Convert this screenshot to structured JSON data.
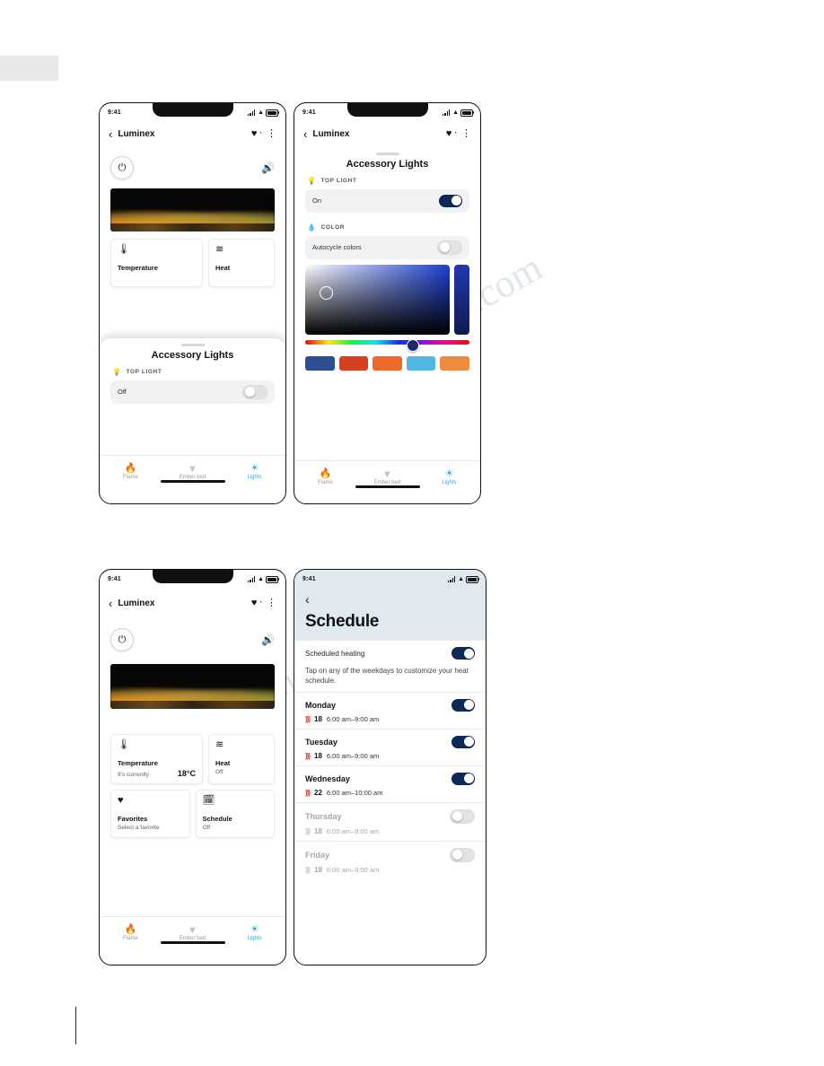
{
  "watermark": {
    "line1": "ve.com",
    "line2": "manualshive."
  },
  "screens": [
    {
      "id": "screen-1",
      "status": {
        "time": "9:41",
        "icons": [
          "signal-icon",
          "wifi-icon",
          "battery-icon"
        ]
      },
      "nav": {
        "back": "‹",
        "title": "Luminex",
        "favorite_icon": "heart-icon",
        "menu_icon": "overflow-menu-icon"
      },
      "controls": {
        "power_icon": "power-icon",
        "speaker_icon": "speaker-icon"
      },
      "tiles": [
        {
          "icon": "thermometer-icon",
          "title": "Temperature",
          "sub": "",
          "value": ""
        },
        {
          "icon": "heat-waves-icon",
          "title": "Heat",
          "sub": "",
          "value": ""
        }
      ],
      "sheet": {
        "title": "Accessory Lights",
        "section_label": "TOP LIGHT",
        "section_icon": "bulb-icon",
        "row_label": "Off",
        "toggle_state": "off"
      },
      "tabs": [
        {
          "icon": "flame-icon",
          "label": "Flame",
          "active": false
        },
        {
          "icon": "ember-bed-icon",
          "label": "Ember bed",
          "active": false
        },
        {
          "icon": "lights-icon",
          "label": "Lights",
          "active": true
        }
      ]
    },
    {
      "id": "screen-2",
      "status": {
        "time": "9:41"
      },
      "nav": {
        "back": "‹",
        "title": "Luminex",
        "favorite_icon": "heart-icon",
        "menu_icon": "overflow-menu-icon"
      },
      "sheet": {
        "title": "Accessory Lights",
        "section_label": "TOP LIGHT",
        "section_icon": "bulb-icon",
        "row_label": "On",
        "toggle_state": "on",
        "color_section_label": "COLOR",
        "color_section_icon": "droplet-icon",
        "autocycle_label": "Autocycle colors",
        "autocycle_state": "off"
      },
      "swatches": [
        "#2d4f91",
        "#d6401f",
        "#ee6a2b",
        "#52b7e2",
        "#ef8a3c"
      ],
      "tabs": [
        {
          "icon": "flame-icon",
          "label": "Flame",
          "active": false
        },
        {
          "icon": "ember-bed-icon",
          "label": "Ember bed",
          "active": false
        },
        {
          "icon": "lights-icon",
          "label": "Lights",
          "active": true
        }
      ]
    },
    {
      "id": "screen-3",
      "status": {
        "time": "9:41"
      },
      "nav": {
        "back": "‹",
        "title": "Luminex",
        "favorite_icon": "heart-icon",
        "menu_icon": "overflow-menu-icon"
      },
      "controls": {
        "power_icon": "power-icon",
        "speaker_icon": "speaker-icon"
      },
      "tiles": [
        {
          "icon": "thermometer-icon",
          "title": "Temperature",
          "sub": "It's currently",
          "value": "18°C"
        },
        {
          "icon": "heat-waves-icon",
          "title": "Heat",
          "sub": "Off",
          "value": ""
        },
        {
          "icon": "heart-filled-icon",
          "title": "Favorites",
          "sub": "Select a favorite",
          "value": ""
        },
        {
          "icon": "calendar-icon",
          "title": "Schedule",
          "sub": "Off",
          "value": ""
        }
      ],
      "tabs": [
        {
          "icon": "flame-icon",
          "label": "Flame",
          "active": false
        },
        {
          "icon": "ember-bed-icon",
          "label": "Ember bed",
          "active": false
        },
        {
          "icon": "lights-icon",
          "label": "Lights",
          "active": true
        }
      ]
    },
    {
      "id": "screen-4",
      "status": {
        "time": "9:41"
      },
      "nav": {
        "back": "‹"
      },
      "title": "Schedule",
      "heating_row": {
        "label": "Scheduled heating",
        "toggle_state": "on"
      },
      "note": "Tap on any of the weekdays to customize your heat schedule.",
      "days": [
        {
          "name": "Monday",
          "temp": "18",
          "times": "6:00 am–9:00 am",
          "toggle_state": "on"
        },
        {
          "name": "Tuesday",
          "temp": "18",
          "times": "6:00 am–9:00 am",
          "toggle_state": "on"
        },
        {
          "name": "Wednesday",
          "temp": "22",
          "times": "6:00 am–10:00 am",
          "toggle_state": "on"
        },
        {
          "name": "Thursday",
          "temp": "18",
          "times": "6:00 am–9:00 am",
          "toggle_state": "off"
        },
        {
          "name": "Friday",
          "temp": "18",
          "times": "6:00 am–9:00 am",
          "toggle_state": "off"
        }
      ]
    }
  ]
}
